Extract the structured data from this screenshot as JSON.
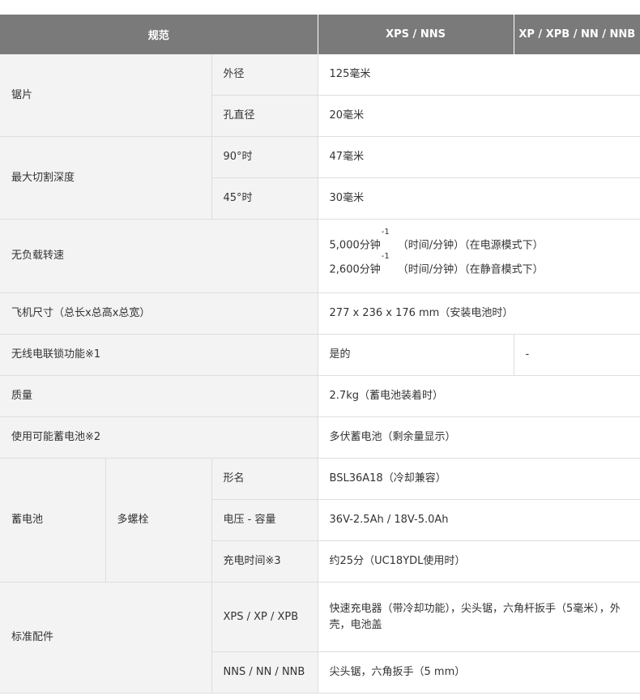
{
  "header": {
    "spec": "规范",
    "col1": "XPS / NNS",
    "col2": "XP / XPB / NN / NNB"
  },
  "rows": {
    "blade": {
      "label": "锯片",
      "outer_label": "外径",
      "outer_value": "125毫米",
      "bore_label": "孔直径",
      "bore_value": "20毫米"
    },
    "cut_depth": {
      "label": "最大切割深度",
      "deg90_label": "90°时",
      "deg90_value": "47毫米",
      "deg45_label": "45°时",
      "deg45_value": "30毫米"
    },
    "no_load_speed": {
      "label": "无负载转速",
      "line1_value": "5,000分钟",
      "line1_sup": "-1",
      "line1_unit": "（时间/分钟）",
      "line1_mode": "（在电源模式下）",
      "line2_value": "2,600分钟",
      "line2_sup": "-1",
      "line2_unit": "（时间/分钟）",
      "line2_mode": "（在静音模式下）"
    },
    "dimensions": {
      "label": "飞机尺寸（总长x总高x总宽）",
      "value": "277 x 236 x 176 mm（安装电池时）"
    },
    "wireless": {
      "label": "无线电联锁功能※1",
      "value1": "是的",
      "value2": "-"
    },
    "weight": {
      "label": "质量",
      "value": "2.7kg（蓄电池装着时）"
    },
    "usable_battery": {
      "label": "使用可能蓄电池※2",
      "value": "多伏蓄电池（剩余量显示）"
    },
    "battery": {
      "label": "蓄电池",
      "sub_label": "多螺栓",
      "model_label": "形名",
      "model_value": "BSL36A18（冷却兼容）",
      "voltage_label": "电压 - 容量",
      "voltage_value": "36V-2.5Ah / 18V-5.0Ah",
      "charge_label": "充电时间※3",
      "charge_value": "约25分（UC18YDL使用时）"
    },
    "accessories": {
      "label": "标准配件",
      "xps_label": "XPS / XP / XPB",
      "xps_value": "快速充电器（带冷却功能），尖头锯，六角杆扳手（5毫米），外壳，电池盖",
      "nns_label": "NNS / NN / NNB",
      "nns_value": "尖头锯，六角扳手（5 mm）"
    }
  }
}
